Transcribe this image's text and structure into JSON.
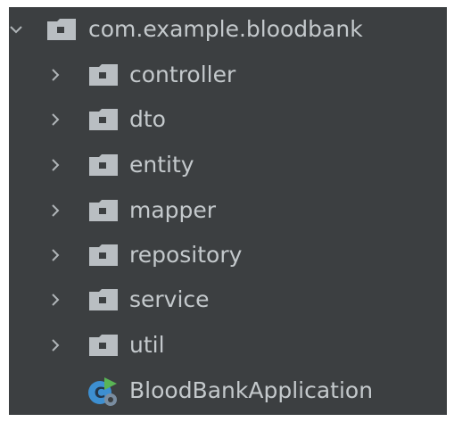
{
  "colors": {
    "panel_background": "#3c3f41",
    "text": "#c4c9cc",
    "folder": "#b9bec2",
    "chevron": "#b0b5b8",
    "app_icon_blue": "#3d8fd1",
    "app_icon_green": "#59b455"
  },
  "project_tree": {
    "root": {
      "label": "com.example.bloodbank",
      "expanded": true,
      "icon": "package-folder-icon"
    },
    "packages": [
      {
        "label": "controller",
        "expanded": false,
        "icon": "package-folder-icon"
      },
      {
        "label": "dto",
        "expanded": false,
        "icon": "package-folder-icon"
      },
      {
        "label": "entity",
        "expanded": false,
        "icon": "package-folder-icon"
      },
      {
        "label": "mapper",
        "expanded": false,
        "icon": "package-folder-icon"
      },
      {
        "label": "repository",
        "expanded": false,
        "icon": "package-folder-icon"
      },
      {
        "label": "service",
        "expanded": false,
        "icon": "package-folder-icon"
      },
      {
        "label": "util",
        "expanded": false,
        "icon": "package-folder-icon"
      }
    ],
    "main_class": {
      "label": "BloodBankApplication",
      "icon": "spring-boot-application-icon"
    }
  }
}
